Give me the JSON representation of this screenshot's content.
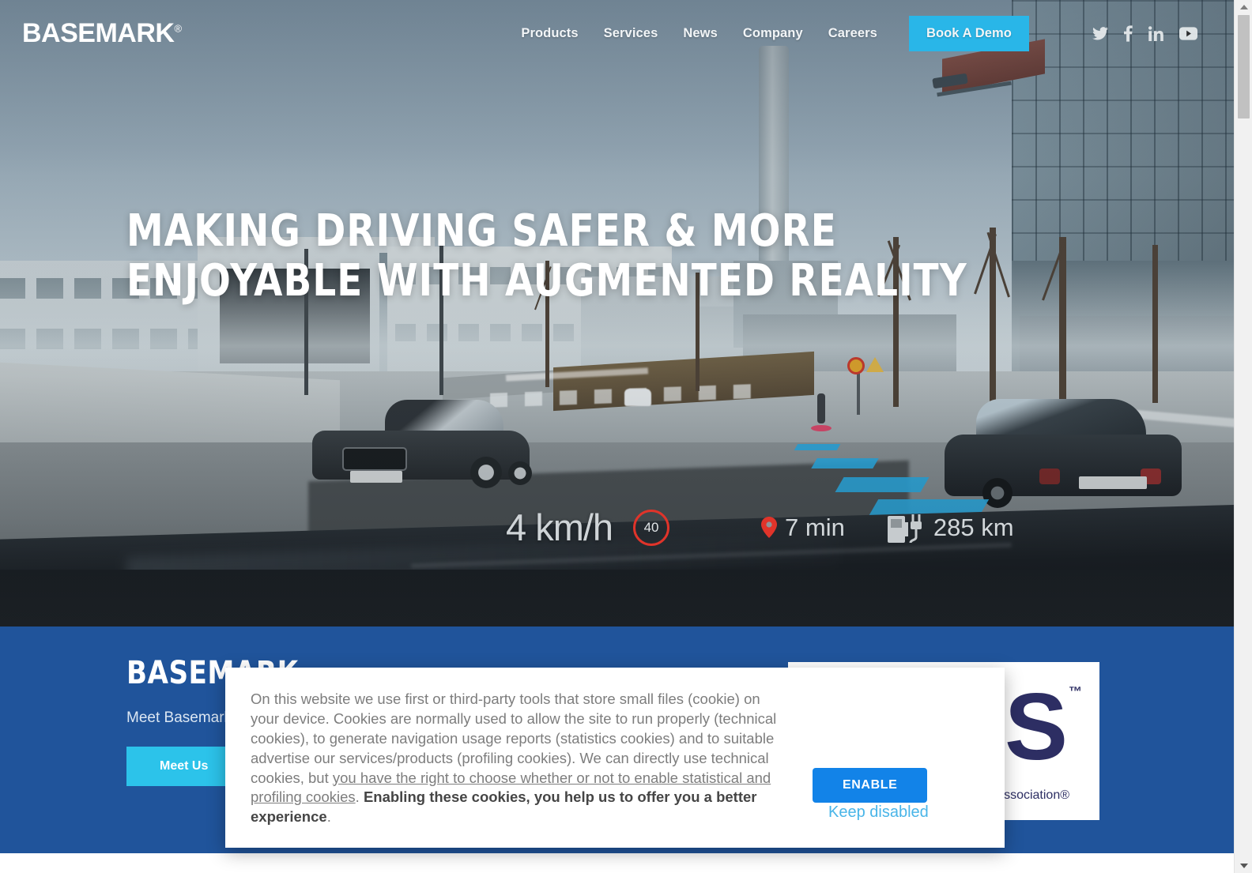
{
  "header": {
    "logo": "BASEMARK",
    "logo_mark": "®",
    "nav": [
      {
        "label": "Products"
      },
      {
        "label": "Services"
      },
      {
        "label": "News"
      },
      {
        "label": "Company"
      },
      {
        "label": "Careers"
      }
    ],
    "cta": "Book A Demo",
    "socials": [
      {
        "name": "twitter-icon"
      },
      {
        "name": "facebook-icon"
      },
      {
        "name": "linkedin-icon"
      },
      {
        "name": "youtube-icon"
      }
    ],
    "cta_color": "#29b6e8"
  },
  "hero": {
    "headline_line1": "Making Driving Safer & More",
    "headline_line2": "Enjoyable With Augmented Reality",
    "hud": {
      "speed": "4 km/h",
      "speed_limit": "40",
      "eta": "7 min",
      "range": "285 km",
      "speed_limit_color": "#e0342a",
      "pin_color": "#e0342a",
      "ar_path_color": "#2ba9e0"
    }
  },
  "promo": {
    "title": "Basemark",
    "subtitle": "Meet Basemark",
    "button": "Meet Us",
    "background_color": "#20549b",
    "button_color": "#2cc3ea",
    "award": {
      "logo_letter": "S",
      "trademark": "™",
      "caption": "Association®",
      "color": "#2d2e63"
    }
  },
  "cookie_dialog": {
    "text_part1": "On this website we use first or third-party tools that store small files (cookie) on your device. Cookies are normally used to allow the site to run properly (technical cookies), to generate navigation usage reports (statistics cookies) and to suitable advertise our services/products (profiling cookies). We can directly use technical cookies, but ",
    "text_link": "you have the right to choose whether or not to enable statistical and profiling cookies",
    "text_part2": ". ",
    "text_bold": "Enabling these cookies, you help us to offer you a better experience",
    "text_part3": ".",
    "enable_label": "ENABLE",
    "keep_disabled_label": "Keep disabled",
    "enable_color": "#1283e8",
    "keep_disabled_color": "#49b5e8"
  },
  "scrollbar": {
    "up_arrow": "scroll-up",
    "down_arrow": "scroll-down"
  }
}
